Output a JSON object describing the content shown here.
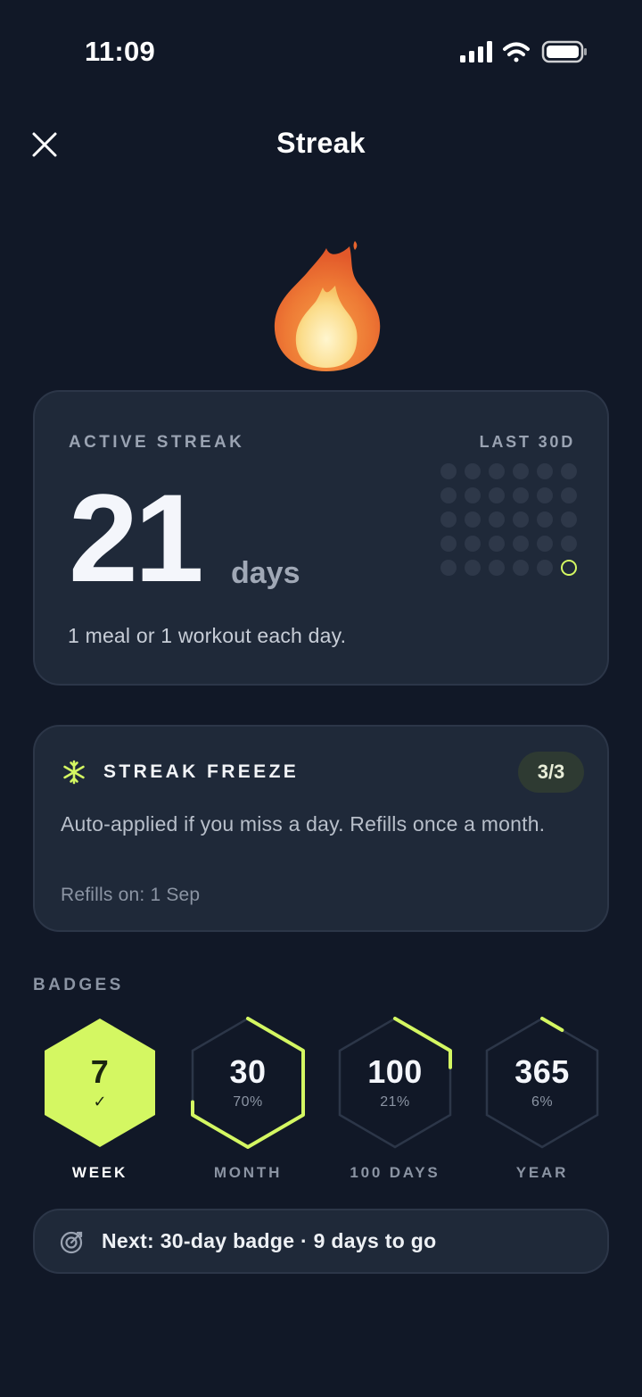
{
  "status_bar": {
    "time": "11:09"
  },
  "nav": {
    "title": "Streak"
  },
  "streak": {
    "label": "ACTIVE STREAK",
    "calendar_label": "LAST 30D",
    "count": "21",
    "unit": "days",
    "rule": "1 meal or 1 workout each day.",
    "calendar_days": 30,
    "calendar_today_index": 29
  },
  "freeze": {
    "title": "STREAK FREEZE",
    "count": "3/3",
    "description": "Auto-applied if you miss a day. Refills once a month.",
    "refill": "Refills on: 1 Sep"
  },
  "badges_section": {
    "label": "BADGES",
    "items": [
      {
        "value": "7",
        "caption": "WEEK",
        "progress": "",
        "progress_fraction": 1.0,
        "earned": true
      },
      {
        "value": "30",
        "caption": "MONTH",
        "progress": "70%",
        "progress_fraction": 0.7,
        "earned": false
      },
      {
        "value": "100",
        "caption": "100 DAYS",
        "progress": "21%",
        "progress_fraction": 0.21,
        "earned": false
      },
      {
        "value": "365",
        "caption": "YEAR",
        "progress": "6%",
        "progress_fraction": 0.06,
        "earned": false
      }
    ]
  },
  "next": {
    "text": "Next: 30-day badge · 9 days to go"
  },
  "colors": {
    "background": "#111827",
    "card": "#1f2939",
    "accent": "#d4f762",
    "muted": "#8b94a3"
  }
}
